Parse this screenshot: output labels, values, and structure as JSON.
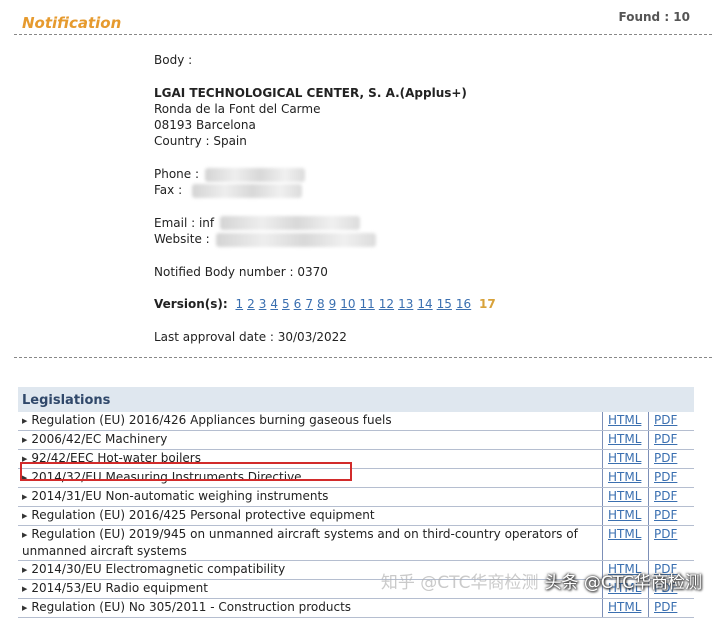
{
  "header": {
    "title": "Notification",
    "found_label": "Found : 10"
  },
  "body_info": {
    "body_label": "Body :",
    "org_name": "LGAI TECHNOLOGICAL CENTER, S. A.(Applus+)",
    "address_line1": "Ronda de la Font del Carme",
    "address_line2": "08193 Barcelona",
    "country": "Country : Spain",
    "phone_label": "Phone :",
    "fax_label": "Fax :",
    "email_label": "Email : inf",
    "website_label": "Website : ",
    "notified_body_number": "Notified Body number : 0370",
    "versions_label": "Version(s):",
    "versions": [
      "1",
      "2",
      "3",
      "4",
      "5",
      "6",
      "7",
      "8",
      "9",
      "10",
      "11",
      "12",
      "13",
      "14",
      "15",
      "16"
    ],
    "current_version": "17",
    "last_approval": "Last approval date : 30/03/2022"
  },
  "legislations": {
    "heading": "Legislations",
    "html_label": "HTML",
    "pdf_label": "PDF",
    "rows": [
      {
        "name": "Regulation (EU) 2016/426 Appliances burning gaseous fuels"
      },
      {
        "name": "2006/42/EC Machinery"
      },
      {
        "name": "92/42/EEC Hot-water boilers"
      },
      {
        "name": "2014/32/EU Measuring Instruments Directive",
        "highlighted": true
      },
      {
        "name": "2014/31/EU Non-automatic weighing instruments"
      },
      {
        "name": "Regulation (EU) 2016/425 Personal protective equipment"
      },
      {
        "name": "Regulation (EU) 2019/945 on unmanned aircraft systems and on third-country operators of unmanned aircraft systems"
      },
      {
        "name": "2014/30/EU Electromagnetic compatibility"
      },
      {
        "name": "2014/53/EU Radio equipment"
      },
      {
        "name": "Regulation (EU) No 305/2011 - Construction products"
      }
    ]
  },
  "watermark": {
    "faint": "知乎 @CTC华商检测",
    "text": "头条 @CTC华商检测"
  },
  "colors": {
    "title_orange": "#e69a2e",
    "link_blue": "#3a6fb0",
    "highlight_red": "#d22b2b",
    "legislation_header_bg": "#dfe7ef"
  }
}
